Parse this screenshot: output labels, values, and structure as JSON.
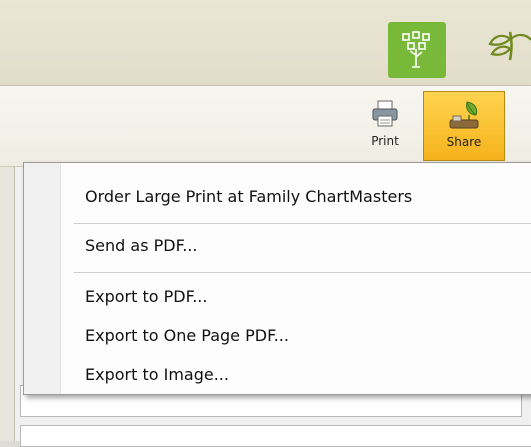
{
  "ribbon": {
    "print_label": "Print",
    "share_label": "Share"
  },
  "menu": {
    "items": [
      {
        "label": "Order Large Print at Family ChartMasters"
      },
      {
        "label": "Send as PDF..."
      },
      {
        "label": "Export to PDF..."
      },
      {
        "label": "Export to One Page PDF..."
      },
      {
        "label": "Export to Image..."
      }
    ]
  },
  "colors": {
    "tree_button": "#79b93a",
    "share_highlight": "#f5b31c",
    "topbar": "#e6e2cf"
  },
  "icons": [
    "family-tree-icon",
    "leaf-logo-icon",
    "printer-icon",
    "share-icon"
  ]
}
